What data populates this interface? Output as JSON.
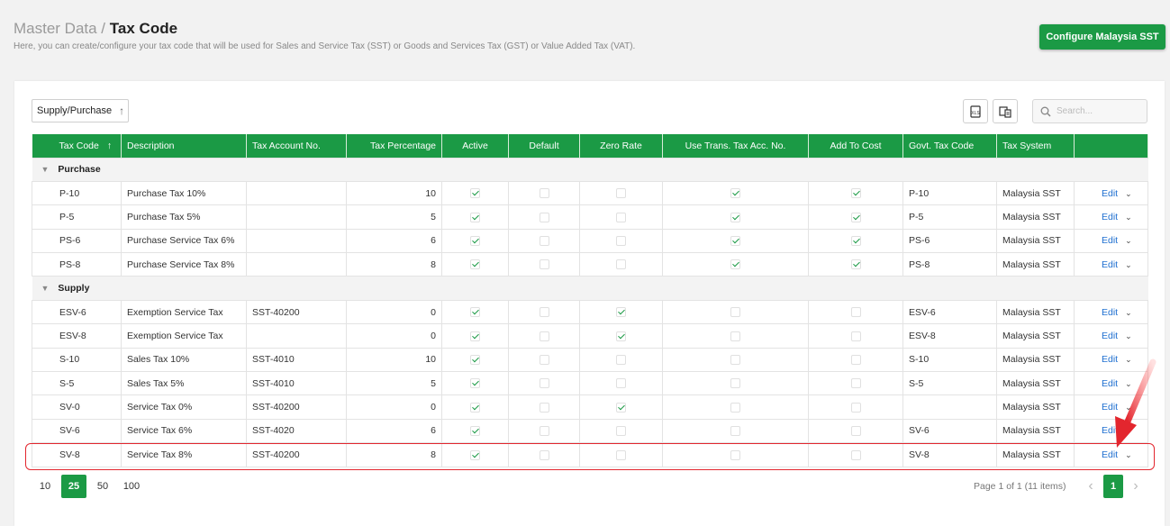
{
  "header": {
    "breadcrumb_parent": "Master Data /",
    "title": "Tax Code",
    "subtitle": "Here, you can create/configure your tax code that will be used for Sales and Service Tax (SST) or Goods and Services Tax (GST) or Value Added Tax (VAT).",
    "configure_button": "Configure Malaysia SST"
  },
  "toolbar": {
    "group_chip": "Supply/Purchase",
    "search_placeholder": "Search..."
  },
  "columns": [
    "Tax Code",
    "Description",
    "Tax Account No.",
    "Tax Percentage",
    "Active",
    "Default",
    "Zero Rate",
    "Use Trans. Tax Acc. No.",
    "Add To Cost",
    "Govt. Tax Code",
    "Tax System"
  ],
  "edit_label": "Edit",
  "groups": [
    {
      "name": "Purchase",
      "rows": [
        {
          "code": "P-10",
          "desc": "Purchase Tax 10%",
          "acc": "",
          "pct": "10",
          "active": true,
          "default": false,
          "zero": false,
          "trans": true,
          "cost": true,
          "govt": "P-10",
          "system": "Malaysia SST"
        },
        {
          "code": "P-5",
          "desc": "Purchase Tax 5%",
          "acc": "",
          "pct": "5",
          "active": true,
          "default": false,
          "zero": false,
          "trans": true,
          "cost": true,
          "govt": "P-5",
          "system": "Malaysia SST"
        },
        {
          "code": "PS-6",
          "desc": "Purchase Service Tax 6%",
          "acc": "",
          "pct": "6",
          "active": true,
          "default": false,
          "zero": false,
          "trans": true,
          "cost": true,
          "govt": "PS-6",
          "system": "Malaysia SST"
        },
        {
          "code": "PS-8",
          "desc": "Purchase Service Tax 8%",
          "acc": "",
          "pct": "8",
          "active": true,
          "default": false,
          "zero": false,
          "trans": true,
          "cost": true,
          "govt": "PS-8",
          "system": "Malaysia SST"
        }
      ]
    },
    {
      "name": "Supply",
      "rows": [
        {
          "code": "ESV-6",
          "desc": "Exemption Service Tax",
          "acc": "SST-40200",
          "pct": "0",
          "active": true,
          "default": false,
          "zero": true,
          "trans": false,
          "cost": false,
          "govt": "ESV-6",
          "system": "Malaysia SST"
        },
        {
          "code": "ESV-8",
          "desc": "Exemption Service Tax",
          "acc": "",
          "pct": "0",
          "active": true,
          "default": false,
          "zero": true,
          "trans": false,
          "cost": false,
          "govt": "ESV-8",
          "system": "Malaysia SST"
        },
        {
          "code": "S-10",
          "desc": "Sales Tax 10%",
          "acc": "SST-4010",
          "pct": "10",
          "active": true,
          "default": false,
          "zero": false,
          "trans": false,
          "cost": false,
          "govt": "S-10",
          "system": "Malaysia SST"
        },
        {
          "code": "S-5",
          "desc": "Sales Tax 5%",
          "acc": "SST-4010",
          "pct": "5",
          "active": true,
          "default": false,
          "zero": false,
          "trans": false,
          "cost": false,
          "govt": "S-5",
          "system": "Malaysia SST"
        },
        {
          "code": "SV-0",
          "desc": "Service Tax 0%",
          "acc": "SST-40200",
          "pct": "0",
          "active": true,
          "default": false,
          "zero": true,
          "trans": false,
          "cost": false,
          "govt": "",
          "system": "Malaysia SST"
        },
        {
          "code": "SV-6",
          "desc": "Service Tax 6%",
          "acc": "SST-4020",
          "pct": "6",
          "active": true,
          "default": false,
          "zero": false,
          "trans": false,
          "cost": false,
          "govt": "SV-6",
          "system": "Malaysia SST"
        },
        {
          "code": "SV-8",
          "desc": "Service Tax 8%",
          "acc": "SST-40200",
          "pct": "8",
          "active": true,
          "default": false,
          "zero": false,
          "trans": false,
          "cost": false,
          "govt": "SV-8",
          "system": "Malaysia SST"
        }
      ]
    }
  ],
  "pager": {
    "sizes": [
      "10",
      "25",
      "50",
      "100"
    ],
    "active_size": "25",
    "info": "Page 1 of 1 (11 items)",
    "current_page": "1"
  },
  "colors": {
    "accent": "#1b9a45",
    "link": "#1e6fd0",
    "highlight": "#e3262e"
  }
}
